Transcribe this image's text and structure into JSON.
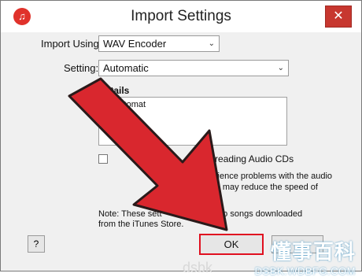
{
  "window": {
    "title": "Import Settings",
    "close_icon": "close-icon",
    "app_icon": "itunes-icon"
  },
  "import_using": {
    "label": "Import Using:",
    "value": "WAV Encoder"
  },
  "setting": {
    "label": "Setting:",
    "value": "Automatic"
  },
  "details": {
    "label": "Details",
    "text": "All automat"
  },
  "error_correction": {
    "label": "when reading Audio CDs"
  },
  "help_text": {
    "line1": "experience problems with the audio",
    "line2": "This may reduce the speed of"
  },
  "note": {
    "line1": "Note: These sett",
    "line1_end": "ply to songs downloaded",
    "line2": "from the iTunes Store."
  },
  "buttons": {
    "help": "?",
    "ok": "OK"
  },
  "watermark": {
    "chinese": "懂事百科",
    "domain": "DSBK.WDBFG.COM",
    "bottom": "dsbk"
  },
  "colors": {
    "arrow": "#d9272e",
    "ok_highlight": "#e01020"
  }
}
